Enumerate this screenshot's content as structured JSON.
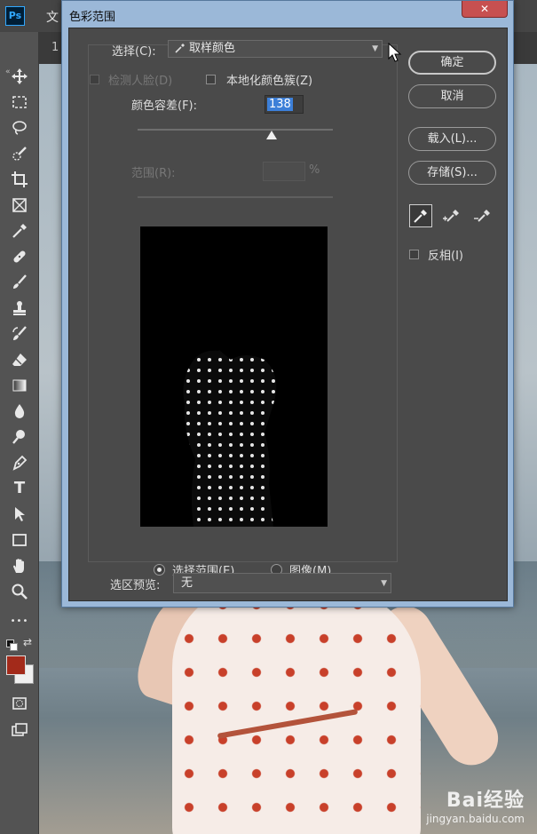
{
  "app": {
    "logo": "Ps",
    "menu_partial": "文",
    "tab_partial": "1"
  },
  "toolbar": {
    "collapse_glyph": "«",
    "tools": [
      "move-icon",
      "marquee-icon",
      "lasso-icon",
      "quick-select-icon",
      "crop-icon",
      "frame-icon",
      "eyedropper-icon",
      "healing-icon",
      "brush-icon",
      "stamp-icon",
      "history-brush-icon",
      "eraser-icon",
      "gradient-icon",
      "blur-icon",
      "dodge-icon",
      "pen-icon",
      "type-icon",
      "path-select-icon",
      "rectangle-icon",
      "hand-icon",
      "zoom-icon",
      "more-icon"
    ],
    "type_glyph": "T",
    "more_glyph": "•••",
    "foreground_color": "#a32a1a",
    "background_color": "#f0f0f0"
  },
  "dialog": {
    "title": "色彩范围",
    "close_glyph": "✕",
    "select_label": "选择(C):",
    "select_value": "取样颜色",
    "detect_faces": "检测人脸(D)",
    "localized_clusters": "本地化颜色簇(Z)",
    "fuzziness_label": "颜色容差(F):",
    "fuzziness_value": "138",
    "range_label": "范围(R):",
    "range_unit": "%",
    "radio_selection": "选择范围(E)",
    "radio_image": "图像(M)",
    "selection_preview_label": "选区预览:",
    "selection_preview_value": "无",
    "buttons": {
      "ok": "确定",
      "cancel": "取消",
      "load": "载入(L)...",
      "save": "存储(S)..."
    },
    "eyedroppers": [
      "eyedropper-icon",
      "eyedropper-plus-icon",
      "eyedropper-minus-icon"
    ],
    "invert_label": "反相(I)"
  },
  "watermark": {
    "brand": "Bai经验",
    "url": "jingyan.baidu.com"
  }
}
